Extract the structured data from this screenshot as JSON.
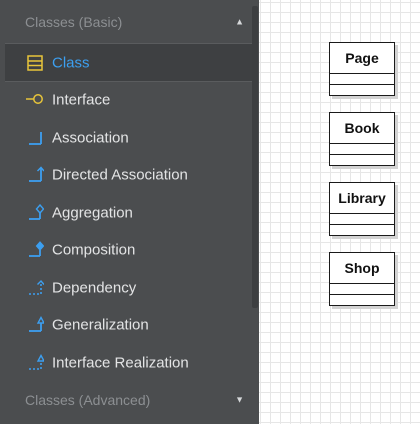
{
  "palette": {
    "sections": [
      {
        "title": "Classes (Basic)",
        "caret": "▲"
      },
      {
        "title": "Classes (Advanced)",
        "caret": "▼"
      }
    ],
    "items": [
      {
        "label": "Class",
        "icon": "class-icon",
        "selected": true
      },
      {
        "label": "Interface",
        "icon": "interface-icon",
        "selected": false
      },
      {
        "label": "Association",
        "icon": "association-icon",
        "selected": false
      },
      {
        "label": "Directed Association",
        "icon": "directed-association-icon",
        "selected": false
      },
      {
        "label": "Aggregation",
        "icon": "aggregation-icon",
        "selected": false
      },
      {
        "label": "Composition",
        "icon": "composition-icon",
        "selected": false
      },
      {
        "label": "Dependency",
        "icon": "dependency-icon",
        "selected": false
      },
      {
        "label": "Generalization",
        "icon": "generalization-icon",
        "selected": false
      },
      {
        "label": "Interface Realization",
        "icon": "interface-realization-icon",
        "selected": false
      }
    ]
  },
  "diagram": {
    "classes": [
      {
        "name": "Page"
      },
      {
        "name": "Book"
      },
      {
        "name": "Library"
      },
      {
        "name": "Shop"
      }
    ]
  },
  "colors": {
    "panel_bg": "#4b4d4f",
    "selected_bg": "#3e4042",
    "accent_blue": "#3c9ff0",
    "class_icon_yellow": "#e8c53a",
    "text": "#e3e4e5",
    "header_text": "#8c8f92"
  }
}
